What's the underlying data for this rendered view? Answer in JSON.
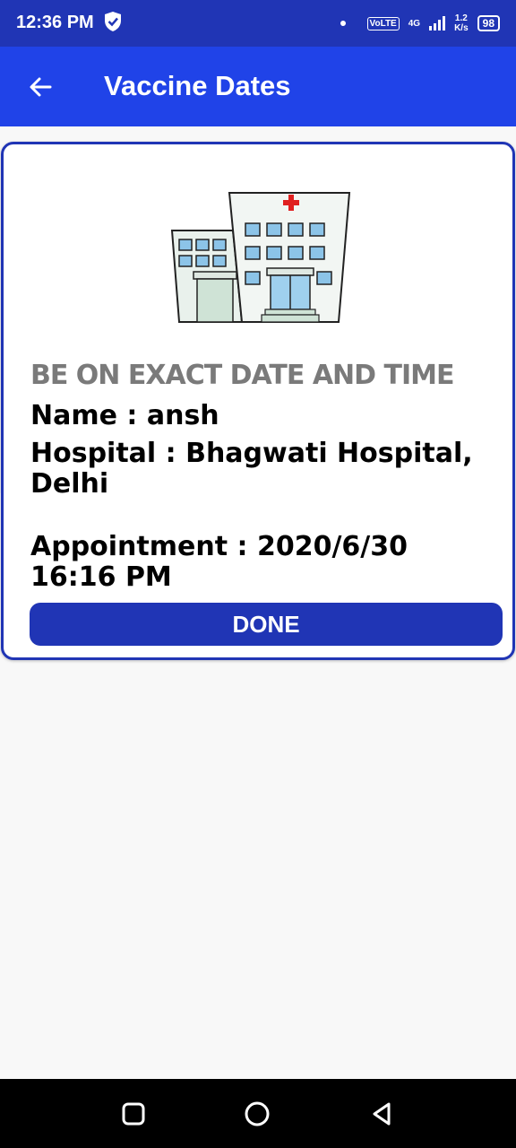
{
  "status_bar": {
    "time": "12:36 PM",
    "network_tag": "VoLTE",
    "network_gen": "4G",
    "speed_value": "1.2",
    "speed_unit": "K/s",
    "battery": "98",
    "icons": [
      "shield-icon",
      "dot-icon",
      "signal-icon",
      "battery-icon"
    ]
  },
  "app_bar": {
    "title": "Vaccine Dates",
    "back_icon": "arrow-left-icon",
    "color": "#2043e8"
  },
  "card": {
    "illustration": "hospital-building-icon",
    "instruction": "BE ON EXACT DATE AND TIME",
    "name_line": "Name : ansh",
    "hospital_line": "Hospital : Bhagwati Hospital, Delhi",
    "appointment_line": "Appointment : 2020/6/30 16:16 PM",
    "done_label": "DONE",
    "accent_color": "#2035b5"
  },
  "nav_bar": {
    "icons": [
      "square-recent-icon",
      "circle-home-icon",
      "triangle-back-icon"
    ]
  }
}
